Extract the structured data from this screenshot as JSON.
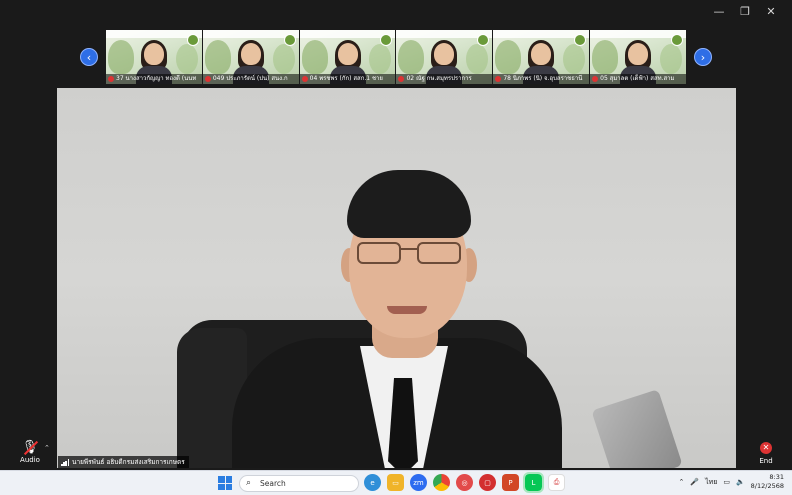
{
  "window": {
    "minimize_icon": "minimize-icon",
    "restore_icon": "restore-icon",
    "close_icon": "close-icon"
  },
  "gallery": {
    "prev_icon": "chevron-left-icon",
    "next_icon": "chevron-right-icon",
    "participants": [
      {
        "name": "37 นางสาวกัญญา ทองดี (นนท"
      },
      {
        "name": "049 ประภารัตน์ (ปน) สนง.ก"
      },
      {
        "name": "04 พรชพร (กัก) สสก.1 ชาย"
      },
      {
        "name": "02 ณัฐ กษ.สมุทรปราการ"
      },
      {
        "name": "78 นิภาพร (นิ) จ.อุบลราชธานี"
      },
      {
        "name": "05 สุมาลต (เด็ฟ้า) สสท.สาม"
      }
    ]
  },
  "speaker": {
    "name": "นายพีรพันธ์ อธิบดีกรมส่งเสริมการเกษตร"
  },
  "controls": {
    "audio_label": "Audio",
    "end_label": "End",
    "end_color": "#d33333"
  },
  "taskbar": {
    "search_placeholder": "Search",
    "language": "ไทย",
    "time": "8:31",
    "date": "8/12/2568"
  }
}
